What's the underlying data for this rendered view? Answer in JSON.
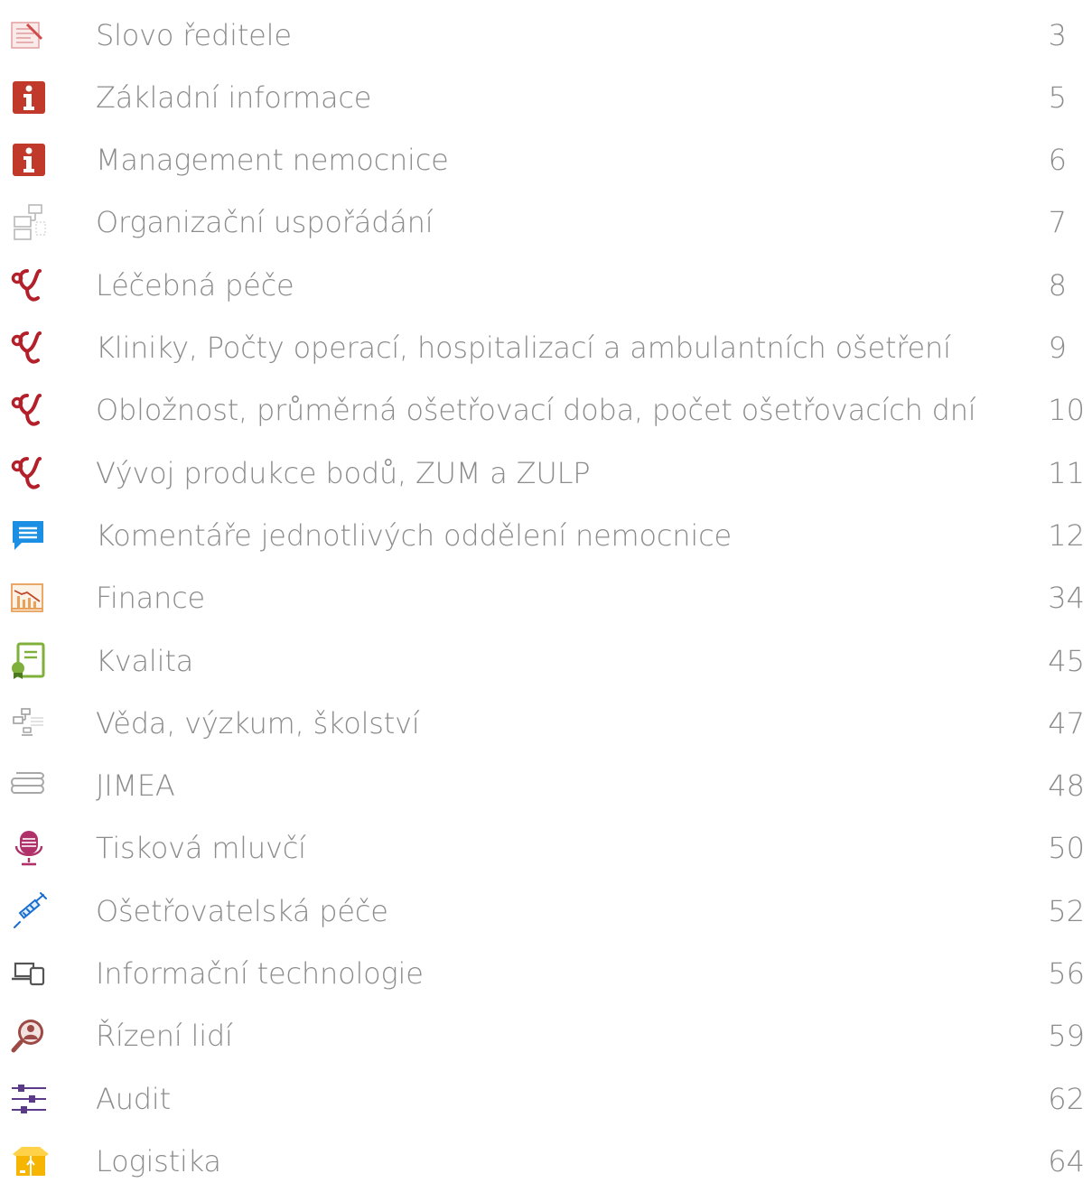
{
  "toc": {
    "items": [
      {
        "icon": "director-letter-icon",
        "label": "Slovo ředitele",
        "page": "3"
      },
      {
        "icon": "info-icon",
        "label": "Základní informace",
        "page": "5"
      },
      {
        "icon": "info-icon",
        "label": "Management nemocnice",
        "page": "6"
      },
      {
        "icon": "org-chart-icon",
        "label": "Organizační uspořádání",
        "page": "7"
      },
      {
        "icon": "stethoscope-icon",
        "label": "Léčebná péče",
        "page": "8"
      },
      {
        "icon": "stethoscope-icon",
        "label": "Kliniky, Počty operací, hospitalizací a ambulantních ošetření",
        "page": "9"
      },
      {
        "icon": "stethoscope-icon",
        "label": "Obložnost, průměrná ošetřovací doba, počet ošetřovacích dní",
        "page": "10"
      },
      {
        "icon": "stethoscope-icon",
        "label": "Vývoj produkce bodů, ZUM a ZULP",
        "page": "11"
      },
      {
        "icon": "comment-icon",
        "label": "Komentáře jednotlivých oddělení nemocnice",
        "page": "12"
      },
      {
        "icon": "finance-chart-icon",
        "label": "Finance",
        "page": "34"
      },
      {
        "icon": "certificate-icon",
        "label": "Kvalita",
        "page": "45"
      },
      {
        "icon": "science-network-icon",
        "label": "Věda, výzkum, školství",
        "page": "47"
      },
      {
        "icon": "books-icon",
        "label": "JIMEA",
        "page": "48"
      },
      {
        "icon": "microphone-icon",
        "label": "Tisková mluvčí",
        "page": "50"
      },
      {
        "icon": "syringe-icon",
        "label": "Ošetřovatelská péče",
        "page": "52"
      },
      {
        "icon": "devices-icon",
        "label": "Informační technologie",
        "page": "56"
      },
      {
        "icon": "person-search-icon",
        "label": "Řízení lidí",
        "page": "59"
      },
      {
        "icon": "sliders-icon",
        "label": "Audit",
        "page": "62"
      },
      {
        "icon": "box-icon",
        "label": "Logistika",
        "page": "64"
      }
    ]
  },
  "colors": {
    "text": "#8c8c8c",
    "info_red": "#c0392b",
    "stethoscope_red": "#b3202a",
    "comment_blue": "#1a8fe3",
    "finance_orange": "#e8a05a",
    "quality_green": "#7fb03b",
    "mic_pink": "#b0306a",
    "syringe_blue": "#1a6fd0",
    "person_brown": "#9c4a45",
    "audit_purple": "#5b3a8a",
    "box_yellow": "#f5b500"
  }
}
